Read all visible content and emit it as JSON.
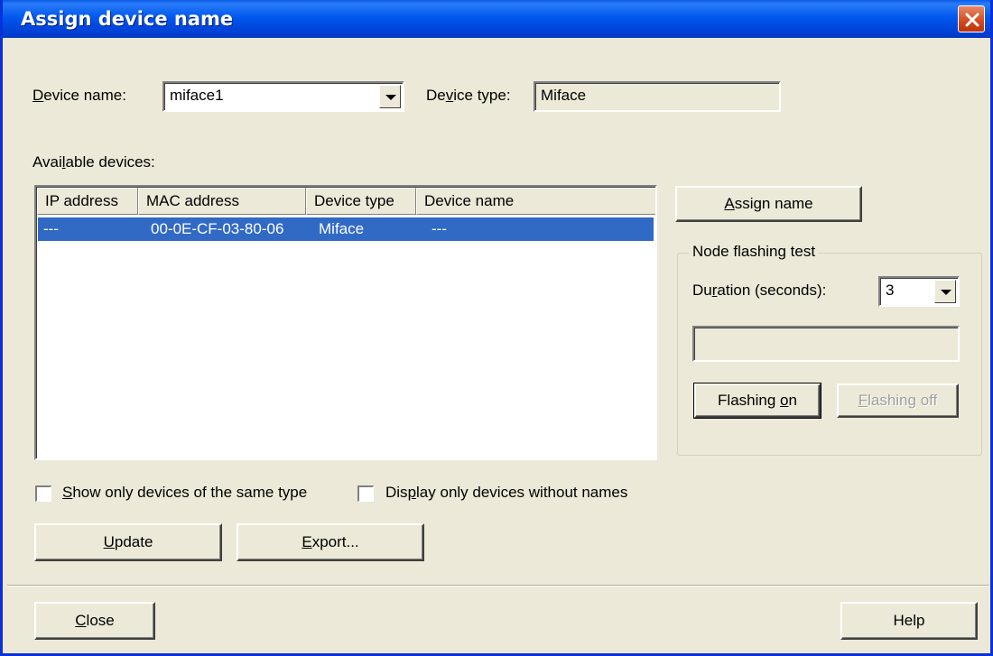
{
  "window": {
    "title": "Assign device name"
  },
  "device_name": {
    "label": "Device name:",
    "value": "miface1"
  },
  "device_type": {
    "label": "Device type:",
    "value": "Miface"
  },
  "available_devices": {
    "label": "Available devices:",
    "columns": [
      "IP address",
      "MAC address",
      "Device type",
      "Device name"
    ],
    "rows": [
      {
        "ip": "---",
        "mac": "00-0E-CF-03-80-06",
        "type": "Miface",
        "name": "---",
        "selected": true
      }
    ]
  },
  "assign_button": "Assign name",
  "node_flashing": {
    "title": "Node flashing test",
    "duration_label": "Duration (seconds):",
    "duration_value": "3",
    "status_text": "",
    "flashing_on": "Flashing on",
    "flashing_off": "Flashing off"
  },
  "checkboxes": {
    "same_type": {
      "label": "Show only devices of the same type",
      "checked": false
    },
    "without_names": {
      "label": "Display only devices without names",
      "checked": false
    }
  },
  "buttons": {
    "update": "Update",
    "export": "Export...",
    "close": "Close",
    "help": "Help"
  },
  "colors": {
    "title_bar": "#0058ee",
    "selection": "#316ac5",
    "face": "#ece9d8",
    "close_button": "#d14a1e"
  }
}
